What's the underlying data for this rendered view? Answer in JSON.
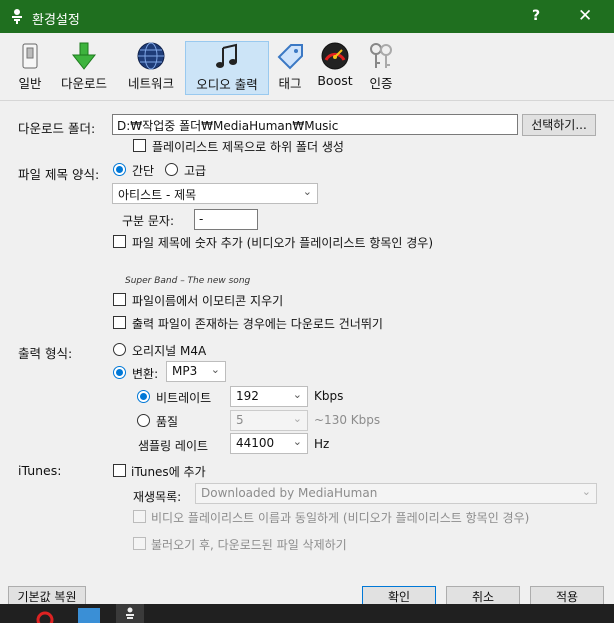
{
  "window": {
    "title": "환경설정",
    "help": "?",
    "close": "✕"
  },
  "toolbar": [
    {
      "id": "general",
      "label": "일반",
      "icon": "switch-icon"
    },
    {
      "id": "download",
      "label": "다운로드",
      "icon": "download-arrow-icon"
    },
    {
      "id": "network",
      "label": "네트워크",
      "icon": "globe-icon"
    },
    {
      "id": "audio",
      "label": "오디오 출력",
      "icon": "music-note-icon",
      "active": true
    },
    {
      "id": "tag",
      "label": "태그",
      "icon": "tag-icon"
    },
    {
      "id": "boost",
      "label": "Boost",
      "icon": "speedometer-icon"
    },
    {
      "id": "auth",
      "label": "인증",
      "icon": "keys-icon"
    }
  ],
  "download_folder": {
    "label": "다운로드 폴더:",
    "value": "D:₩작업중 폴더₩MediaHuman₩Music",
    "browse": "선택하기...",
    "subfolder": "플레이리스트 제목으로 하위 폴더 생성"
  },
  "filename": {
    "label": "파일 제목 양식:",
    "simple": "간단",
    "advanced": "고급",
    "pattern": "아티스트 - 제목",
    "separator_label": "구분 문자:",
    "separator_value": "-",
    "add_number": "파일 제목에 숫자 추가 (비디오가 플레이리스트 항목인 경우)",
    "example": "Super Band – The new song",
    "remove_emoji": "파일이름에서 이모티콘 지우기",
    "skip_existing": "출력 파일이 존재하는 경우에는 다운로드 건너뛰기"
  },
  "output": {
    "label": "출력 형식:",
    "original": "오리지널 M4A",
    "convert": "변환:",
    "format": "MP3",
    "bitrate_label": "비트레이트",
    "bitrate_value": "192",
    "bitrate_unit": "Kbps",
    "quality_label": "품질",
    "quality_value": "5",
    "quality_hint": "~130 Kbps",
    "samplerate_label": "샘플링 레이트",
    "samplerate_value": "44100",
    "samplerate_unit": "Hz"
  },
  "itunes": {
    "label": "iTunes:",
    "add": "iTunes에 추가",
    "playlist_label": "재생목록:",
    "playlist_value": "Downloaded by MediaHuman",
    "same_name": "비디오 플레이리스트 이름과 동일하게 (비디오가 플레이리스트 항목인 경우)",
    "delete_after": "불러오기 후, 다운로드된 파일 삭제하기"
  },
  "buttons": {
    "reset": "기본값 복원",
    "ok": "확인",
    "cancel": "취소",
    "apply": "적용"
  },
  "colors": {
    "titlebar": "#1f6f1f",
    "accent": "#0078d7",
    "active_tab": "#cce4f7"
  }
}
